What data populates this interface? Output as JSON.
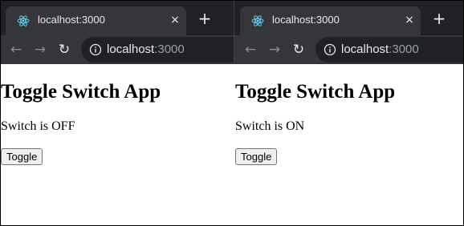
{
  "windows": [
    {
      "tab": {
        "title": "localhost:3000",
        "icon": "react-icon"
      },
      "address": {
        "host": "localhost",
        "port": ":3000"
      },
      "app": {
        "heading": "Toggle Switch App",
        "status": "Switch is OFF",
        "button_label": "Toggle"
      }
    },
    {
      "tab": {
        "title": "localhost:3000",
        "icon": "react-icon"
      },
      "address": {
        "host": "localhost",
        "port": ":3000"
      },
      "app": {
        "heading": "Toggle Switch App",
        "status": "Switch is ON",
        "button_label": "Toggle"
      }
    }
  ],
  "icons": {
    "close": "×",
    "new_tab": "+",
    "back": "←",
    "forward": "→",
    "reload": "↻"
  },
  "colors": {
    "tabstrip": "#202124",
    "tab_active": "#35363a",
    "react_blue": "#61dafb"
  }
}
